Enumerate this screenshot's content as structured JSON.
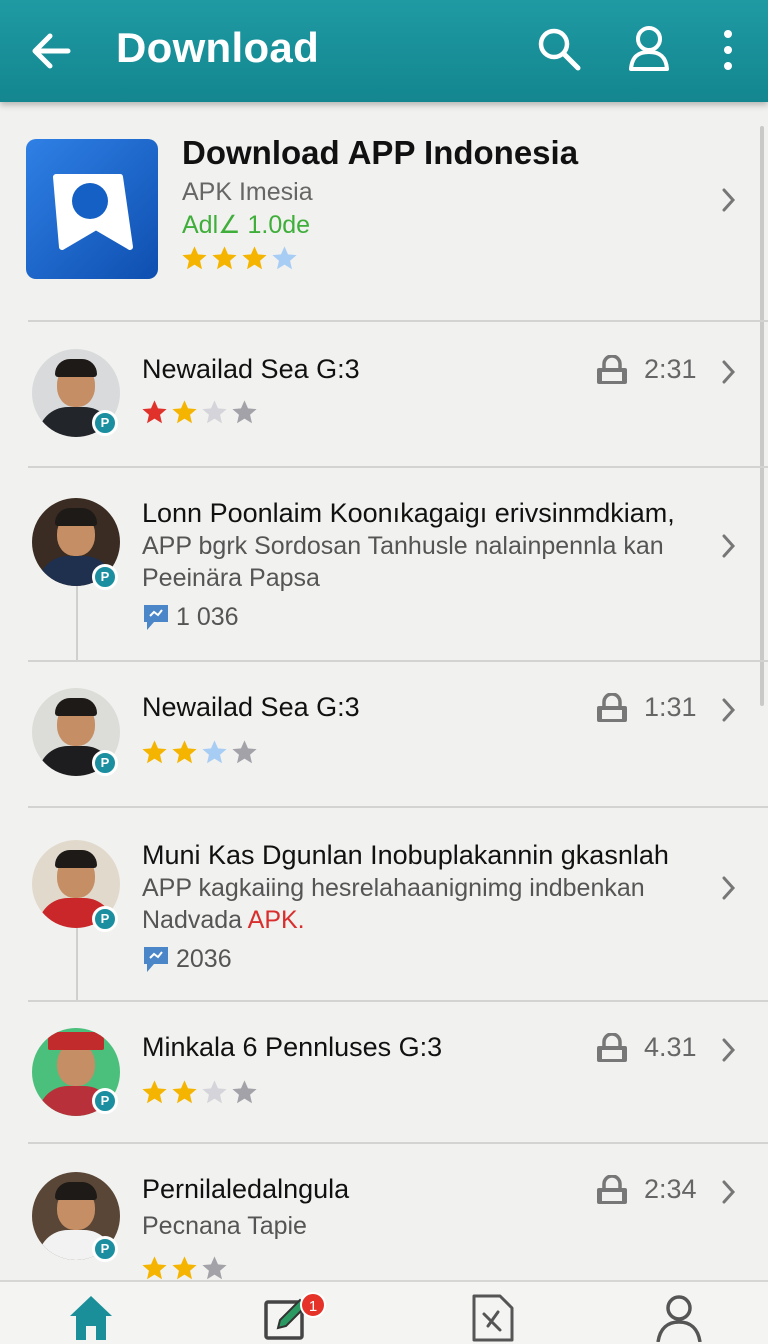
{
  "header": {
    "title": "Download",
    "back_icon": "arrow-left-icon",
    "search_icon": "search-icon",
    "profile_icon": "user-icon",
    "menu_icon": "more-vertical-icon",
    "color": "#1a8f99"
  },
  "featured": {
    "name": "Download APP Indonesia",
    "developer": "APK Imesia",
    "meta": "Adl∠ 1.0de",
    "rating": 3.5
  },
  "items": [
    {
      "title": "Newailad Sea G:3",
      "size": "2:31",
      "rating": 2
    },
    {
      "lines": [
        "Lonn Poonlaim Koonıkagaigı erivsinmdkiam,",
        "APP bgrk Sordosan Tanhusle nalainpennla kan",
        "Peeinära Papsa"
      ],
      "comments": "1 036"
    },
    {
      "title": "Newailad Sea G:3",
      "size": "1:31",
      "rating": 2.5
    },
    {
      "lines": [
        "Muni Kas Dgunlan Inobuplakannin gkasnlah",
        "APP kagkaiing hesrelahaanignimg indbenkan",
        "Nadvada"
      ],
      "line3_highlight": "APK.",
      "comments": "2036"
    },
    {
      "title": "Minkala 6 Pennluses G:3",
      "size": "4.31",
      "rating": 2
    },
    {
      "title": "Pernilaledalngula",
      "subtitle": "Pecnana Tapie",
      "size": "2:34",
      "rating": 2
    }
  ],
  "bottom_nav": {
    "items": [
      "home-icon",
      "edit-icon",
      "document-icon",
      "profile-icon"
    ],
    "badge": "1",
    "active_color": "#1a8f99"
  },
  "colors": {
    "star_gold": "#f4b400",
    "star_red": "#e0312b",
    "star_light": "#a8cdf5",
    "star_gray": "#a2a2a8",
    "rating_green": "#3fae3a"
  }
}
